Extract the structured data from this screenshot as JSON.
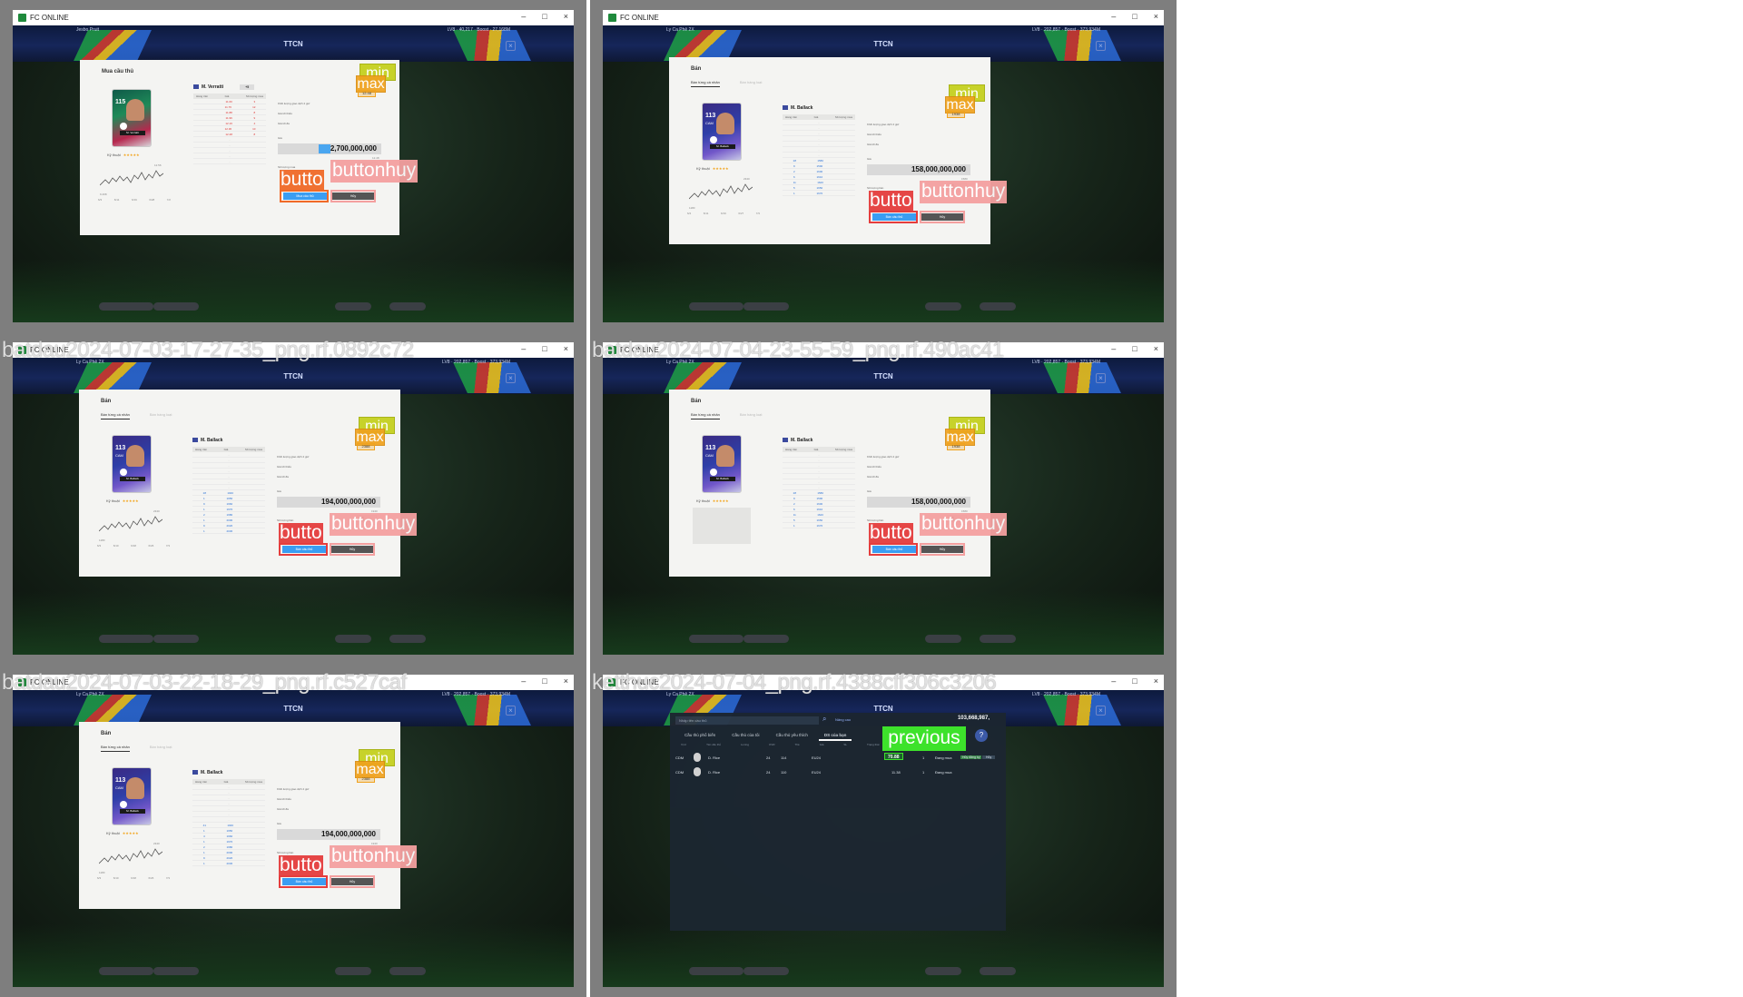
{
  "window": {
    "title": "FC ONLINE"
  },
  "hud": {
    "tiles_top_left": "Jesbo Pruit",
    "tiles_top_right": "LV8 · 40,217 · Boost · 27,168M",
    "tiles_other_left": "Ly Ca Phê 2X",
    "tiles_other_right": "LV8 · 202,857 · Boost · 373,934M"
  },
  "screen_title": "TTCN",
  "tiles": [
    {
      "label": "",
      "kind": "buy",
      "panel_title": "Mua cầu thủ",
      "balance": "27,168,475,947 BP",
      "search_placeholder": "Nhập tên cầu thủ",
      "filter": "Nâng cao",
      "player": {
        "name": "M. Verratti",
        "ovr": "115",
        "pos": "",
        "grade": "+5"
      },
      "stars_label": "Kỹ thuật",
      "stars": "★★★★★",
      "chart_axis": [
        "6/3",
        "6/11",
        "6/19",
        "6/28",
        "7/2"
      ],
      "chart_hi": "12.56",
      "chart_lo": "9.408",
      "table_headers": [
        "Hàng trên",
        "Giá",
        "Số lượng mua"
      ],
      "rows": [
        {
          "a": "",
          "b": "11.60",
          "c": "3",
          "tone": "red"
        },
        {
          "a": "",
          "b": "11.76",
          "c": "12",
          "tone": "red"
        },
        {
          "a": "",
          "b": "11.88",
          "c": "8",
          "tone": "red"
        },
        {
          "a": "",
          "b": "11.96",
          "c": "9",
          "tone": "red"
        },
        {
          "a": "",
          "b": "12.16",
          "c": "4",
          "tone": "red"
        },
        {
          "a": "",
          "b": "12.36",
          "c": "10",
          "tone": "red"
        },
        {
          "a": "",
          "b": "12.48",
          "c": "8",
          "tone": "red"
        },
        {
          "a": "",
          "b": "-",
          "c": "",
          "tone": "blank"
        },
        {
          "a": "",
          "b": "-",
          "c": "",
          "tone": "blank"
        },
        {
          "a": "",
          "b": "-",
          "c": "",
          "tone": "blank"
        },
        {
          "a": "",
          "b": "-",
          "c": "",
          "tone": "blank"
        },
        {
          "a": "",
          "b": "-",
          "c": "",
          "tone": "blank"
        }
      ],
      "right_labels": [
        "Khối lượng giao dịch 2 giờ",
        "Giá tối thiểu",
        "Giá tối đa"
      ],
      "price_label": "Giá",
      "price": "12,700,000,000",
      "price_highlight": "12,",
      "price_note": "12.48",
      "qty_label": "Số lượng mua",
      "qty": "1",
      "ok_label": "Mua cầu thủ",
      "cancel_label": "Hủy",
      "ann_box": "12.48",
      "ann_min": "min",
      "ann_max": "max",
      "ann_butto": "butto",
      "ann_huy": "buttonhuy",
      "butto_tone": "orange"
    },
    {
      "label": "",
      "kind": "sell",
      "panel_title": "Bán",
      "tabs": [
        "Bán từng cá nhân",
        "Bán hàng loạt"
      ],
      "player": {
        "name": "M. Ballack",
        "ovr": "113",
        "pos": "CAM",
        "grade": ""
      },
      "stars_label": "Kỹ thuật",
      "stars": "★★★★★",
      "chart_axis": [
        "6/4",
        "6/11",
        "6/19",
        "6/27",
        "7/3"
      ],
      "chart_hi": "2340",
      "chart_lo": "1180",
      "table_headers": [
        "Hàng trên",
        "Giá",
        "Số lượng mua"
      ],
      "rows": [
        {
          "a": "",
          "b": "-",
          "c": "",
          "tone": "blank"
        },
        {
          "a": "",
          "b": "-",
          "c": "",
          "tone": "blank"
        },
        {
          "a": "",
          "b": "-",
          "c": "",
          "tone": "blank"
        },
        {
          "a": "",
          "b": "-",
          "c": "",
          "tone": "blank"
        },
        {
          "a": "",
          "b": "-",
          "c": "",
          "tone": "blank"
        },
        {
          "a": "",
          "b": "-",
          "c": "",
          "tone": "blank"
        },
        {
          "a": "",
          "b": "-",
          "c": "",
          "tone": "blank"
        },
        {
          "a": "28",
          "b": "1580",
          "c": "",
          "tone": "blue"
        },
        {
          "a": "9",
          "b": "1590",
          "c": "",
          "tone": "blue"
        },
        {
          "a": "2",
          "b": "1600",
          "c": "",
          "tone": "blue"
        },
        {
          "a": "6",
          "b": "1610",
          "c": "",
          "tone": "blue"
        },
        {
          "a": "11",
          "b": "1620",
          "c": "",
          "tone": "blue"
        },
        {
          "a": "5",
          "b": "1650",
          "c": "",
          "tone": "blue"
        },
        {
          "a": "1",
          "b": "1670",
          "c": "",
          "tone": "blue"
        }
      ],
      "right_labels": [
        "Khối lượng giao dịch 2 giờ",
        "Giá tối thiểu",
        "Giá tối đa"
      ],
      "price_label": "Giá",
      "price": "158,000,000,000",
      "price_note": "1580",
      "qty_label": "Số lượng bán",
      "qty": "1",
      "ok_label": "Bán cầu thủ",
      "cancel_label": "Hủy",
      "ann_box": "1938",
      "ann_min": "min",
      "ann_max": "max",
      "ann_butto": "butto",
      "ann_huy": "buttonhuy",
      "butto_tone": "red"
    },
    {
      "label": "batdau2024-07-03-17-27-35_png.rf.0892c72",
      "kind": "sell",
      "panel_title": "Bán",
      "tabs": [
        "Bán từng cá nhân",
        "Bán hàng loạt"
      ],
      "player": {
        "name": "M. Ballack",
        "ovr": "113",
        "pos": "CAM",
        "grade": ""
      },
      "stars_label": "Kỹ thuật",
      "stars": "★★★★★",
      "chart_axis": [
        "6/3",
        "6/10",
        "6/18",
        "6/26",
        "7/3"
      ],
      "chart_hi": "2340",
      "chart_lo": "1180",
      "table_headers": [
        "Hàng trên",
        "Giá",
        "Số lượng mua"
      ],
      "rows": [
        {
          "a": "",
          "b": "-",
          "c": "",
          "tone": "blank"
        },
        {
          "a": "",
          "b": "-",
          "c": "",
          "tone": "blank"
        },
        {
          "a": "",
          "b": "-",
          "c": "",
          "tone": "blank"
        },
        {
          "a": "",
          "b": "-",
          "c": "",
          "tone": "blank"
        },
        {
          "a": "",
          "b": "-",
          "c": "",
          "tone": "blank"
        },
        {
          "a": "",
          "b": "-",
          "c": "",
          "tone": "blank"
        },
        {
          "a": "",
          "b": "-",
          "c": "",
          "tone": "blank"
        },
        {
          "a": "28",
          "b": "1940",
          "c": "",
          "tone": "blue"
        },
        {
          "a": "1",
          "b": "1950",
          "c": "",
          "tone": "blue"
        },
        {
          "a": "9",
          "b": "1960",
          "c": "",
          "tone": "blue"
        },
        {
          "a": "1",
          "b": "1970",
          "c": "",
          "tone": "blue"
        },
        {
          "a": "2",
          "b": "1980",
          "c": "",
          "tone": "blue"
        },
        {
          "a": "1",
          "b": "2000",
          "c": "",
          "tone": "blue"
        },
        {
          "a": "9",
          "b": "2020",
          "c": "",
          "tone": "blue"
        },
        {
          "a": "1",
          "b": "2030",
          "c": "",
          "tone": "blue"
        }
      ],
      "right_labels": [
        "Khối lượng giao dịch 2 giờ",
        "Giá tối thiểu",
        "Giá tối đa"
      ],
      "price_label": "Giá",
      "price": "194,000,000,000",
      "price_note": "1940",
      "qty_label": "Số lượng bán",
      "qty": "1",
      "ok_label": "Bán cầu thủ",
      "cancel_label": "Hủy",
      "ann_box": "2388",
      "ann_min": "min",
      "ann_max": "max",
      "ann_butto": "butto",
      "ann_huy": "buttonhuy",
      "butto_tone": "red"
    },
    {
      "label": "batdau2024-07-04-23-55-59_png.rf.490ac41",
      "kind": "sell",
      "panel_title": "Bán",
      "tabs": [
        "Bán từng cá nhân",
        "Bán hàng loạt"
      ],
      "player": {
        "name": "M. Ballack",
        "ovr": "113",
        "pos": "CAM",
        "grade": ""
      },
      "stars_label": "Kỹ thuật",
      "stars": "★★★★★",
      "chart_axis": [],
      "chart_hi": "",
      "chart_lo": "",
      "table_headers": [
        "Hàng trên",
        "Giá",
        "Số lượng mua"
      ],
      "rows": [
        {
          "a": "",
          "b": "-",
          "c": "",
          "tone": "blank"
        },
        {
          "a": "",
          "b": "-",
          "c": "",
          "tone": "blank"
        },
        {
          "a": "",
          "b": "-",
          "c": "",
          "tone": "blank"
        },
        {
          "a": "",
          "b": "-",
          "c": "",
          "tone": "blank"
        },
        {
          "a": "",
          "b": "-",
          "c": "",
          "tone": "blank"
        },
        {
          "a": "",
          "b": "-",
          "c": "",
          "tone": "blank"
        },
        {
          "a": "",
          "b": "-",
          "c": "",
          "tone": "blank"
        },
        {
          "a": "28",
          "b": "1580",
          "c": "",
          "tone": "blue"
        },
        {
          "a": "9",
          "b": "1590",
          "c": "",
          "tone": "blue"
        },
        {
          "a": "2",
          "b": "1600",
          "c": "",
          "tone": "blue"
        },
        {
          "a": "6",
          "b": "1610",
          "c": "",
          "tone": "blue"
        },
        {
          "a": "11",
          "b": "1620",
          "c": "",
          "tone": "blue"
        },
        {
          "a": "5",
          "b": "1650",
          "c": "",
          "tone": "blue"
        },
        {
          "a": "1",
          "b": "1670",
          "c": "",
          "tone": "blue"
        }
      ],
      "right_labels": [
        "Khối lượng giao dịch 2 giờ",
        "Giá tối thiểu",
        "Giá tối đa"
      ],
      "price_label": "Giá",
      "price": "158,000,000,000",
      "price_note": "1580",
      "qty_label": "Số lượng bán",
      "qty": "1",
      "ok_label": "Bán cầu thủ",
      "cancel_label": "Hủy",
      "ann_box": "1938",
      "ann_min": "min",
      "ann_max": "max",
      "ann_butto": "butto",
      "ann_huy": "buttonhuy",
      "butto_tone": "red"
    },
    {
      "label": "batdau2024-07-03-22-18-29_png.rf.c527caf",
      "kind": "sell",
      "panel_title": "Bán",
      "tabs": [
        "Bán từng cá nhân",
        "Bán hàng loạt"
      ],
      "player": {
        "name": "M. Ballack",
        "ovr": "113",
        "pos": "CAM",
        "grade": ""
      },
      "stars_label": "Kỹ thuật",
      "stars": "★★★★★",
      "chart_axis": [
        "6/3",
        "6/10",
        "6/18",
        "6/26",
        "7/3"
      ],
      "chart_hi": "2340",
      "chart_lo": "1180",
      "table_headers": [
        "Hàng trên",
        "Giá",
        "Số lượng mua"
      ],
      "rows": [
        {
          "a": "",
          "b": "-",
          "c": "",
          "tone": "blank"
        },
        {
          "a": "",
          "b": "-",
          "c": "",
          "tone": "blank"
        },
        {
          "a": "",
          "b": "-",
          "c": "",
          "tone": "blank"
        },
        {
          "a": "",
          "b": "-",
          "c": "",
          "tone": "blank"
        },
        {
          "a": "",
          "b": "-",
          "c": "",
          "tone": "blank"
        },
        {
          "a": "",
          "b": "-",
          "c": "",
          "tone": "blank"
        },
        {
          "a": "",
          "b": "-",
          "c": "",
          "tone": "blank"
        },
        {
          "a": "41",
          "b": "1940",
          "c": "",
          "tone": "blue"
        },
        {
          "a": "1",
          "b": "1950",
          "c": "",
          "tone": "blue"
        },
        {
          "a": "4",
          "b": "1960",
          "c": "",
          "tone": "blue"
        },
        {
          "a": "1",
          "b": "1970",
          "c": "",
          "tone": "blue"
        },
        {
          "a": "2",
          "b": "1980",
          "c": "",
          "tone": "blue"
        },
        {
          "a": "1",
          "b": "2000",
          "c": "",
          "tone": "blue"
        },
        {
          "a": "9",
          "b": "2020",
          "c": "",
          "tone": "blue"
        },
        {
          "a": "1",
          "b": "2030",
          "c": "",
          "tone": "blue"
        }
      ],
      "right_labels": [
        "Khối lượng giao dịch 2 giờ",
        "Giá tối thiểu",
        "Giá tối đa"
      ],
      "price_label": "Giá",
      "price": "194,000,000,000",
      "price_note": "1940",
      "qty_label": "Số lượng bán",
      "qty": "1",
      "ok_label": "Bán cầu thủ",
      "cancel_label": "Hủy",
      "ann_box": "2388",
      "ann_min": "min",
      "ann_max": "max",
      "ann_butto": "butto",
      "ann_huy": "buttonhuy",
      "butto_tone": "red"
    },
    {
      "label": "ketthuc2024-07-04_png.rf.4388cff306c3206",
      "kind": "list",
      "search_placeholder": "Nhập tên cầu thủ",
      "filter": "Nâng cao",
      "balance": "103,668,987,",
      "tabs": [
        "Cầu thủ phổ biến",
        "Cầu thủ của tôi",
        "Cầu thủ yêu thích",
        "DS của bạn"
      ],
      "headers": [
        "Vị trí",
        "Tên cầu thủ",
        "Lương",
        "OVR",
        "Thẻ",
        "Giá",
        "SL",
        "Trạng thái"
      ],
      "rows": [
        {
          "pos": "CDM",
          "name": "D. Rice",
          "wage": "24",
          "ovr": "114",
          "season": "EU24",
          "price": "70.88",
          "qty": "1",
          "status": "Đang mua",
          "action1": "Hủy đăng ký",
          "action2": "Hủy"
        },
        {
          "pos": "CDM",
          "name": "D. Rice",
          "wage": "24",
          "ovr": "110",
          "season": "EU24",
          "price": "11.38",
          "qty": "1",
          "status": "Đang mua",
          "action1": "",
          "action2": ""
        }
      ],
      "ann_prev": "previous"
    }
  ]
}
